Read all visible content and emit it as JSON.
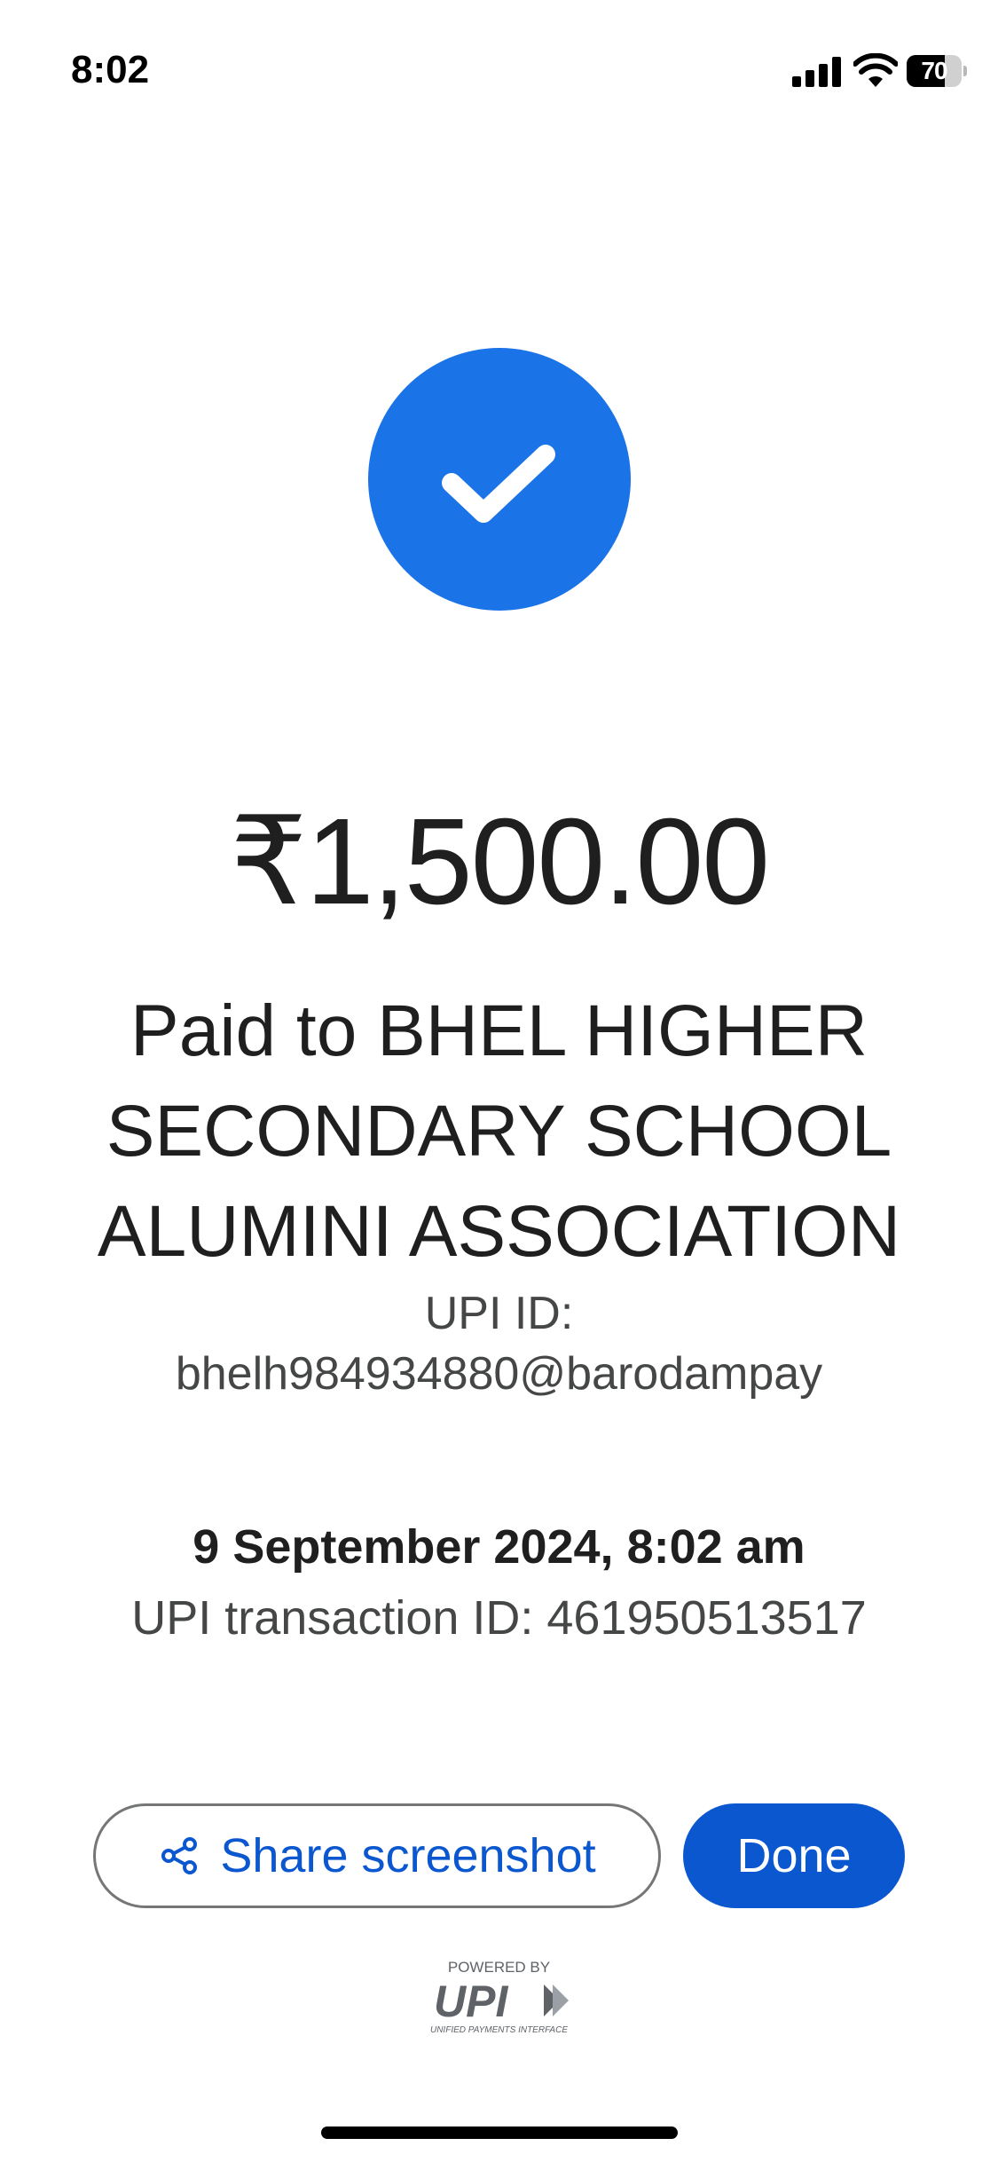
{
  "status_bar": {
    "time": "8:02",
    "battery_level": "70",
    "battery_fraction": 0.7
  },
  "payment": {
    "amount": "₹1,500.00",
    "payee": "Paid to BHEL HIGHER SECONDARY SCHOOL ALUMINI ASSOCIATION",
    "upi_label": "UPI ID:",
    "upi_id": "bhelh984934880@barodampay",
    "datetime": "9 September 2024, 8:02 am",
    "transaction": "UPI transaction ID: 461950513517"
  },
  "actions": {
    "share_label": "Share screenshot",
    "done_label": "Done"
  },
  "footer": {
    "powered_by": "POWERED BY",
    "brand": "UPI",
    "brand_full": "UNIFIED PAYMENTS INTERFACE"
  },
  "colors": {
    "accent": "#1b73e8",
    "button_primary": "#0b57d0",
    "text": "#1f1f1f",
    "text_secondary": "#444746"
  },
  "icons": [
    "cellular-signal-icon",
    "wifi-icon",
    "battery-icon",
    "checkmark-icon",
    "share-icon",
    "upi-logo"
  ]
}
